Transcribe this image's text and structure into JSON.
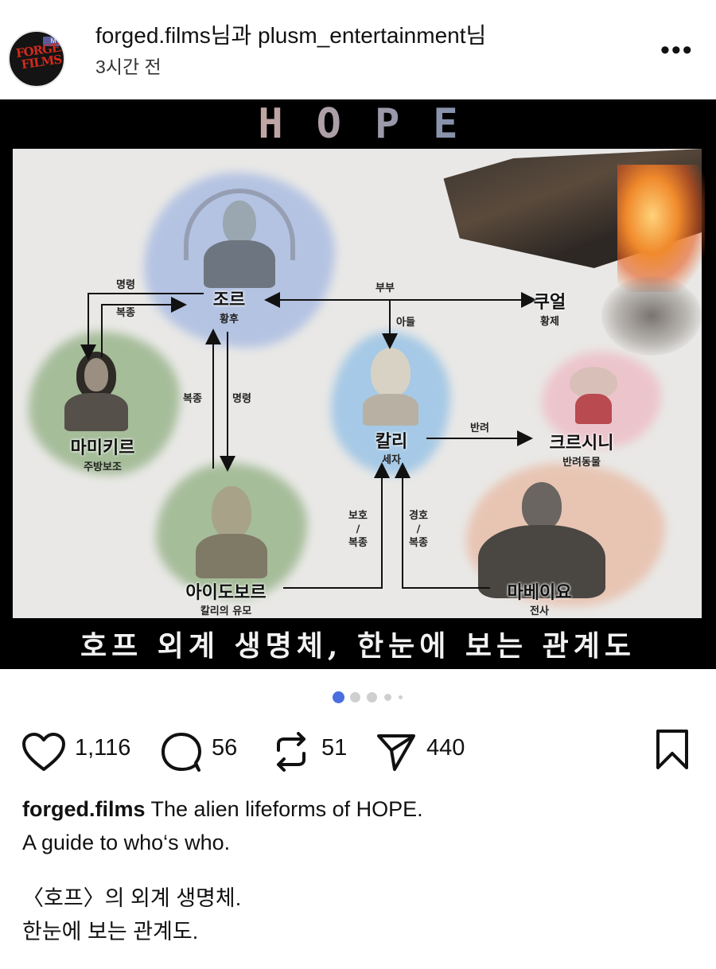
{
  "post": {
    "header": {
      "author_line": "forged.films님과 plusm_entertainment님",
      "time": "3시간 전",
      "avatar": {
        "logo_text": "FORGED FILMS",
        "badge_text": "M"
      },
      "more_icon": "ellipsis-icon"
    },
    "image": {
      "title": "HOPE",
      "caption": "호프 외계 생명체, 한눈에 보는 관계도",
      "characters": [
        {
          "name": "조르",
          "role": "황후"
        },
        {
          "name": "쿠얼",
          "role": "황제"
        },
        {
          "name": "마미키르",
          "role": "주방보조"
        },
        {
          "name": "칼리",
          "role": "세자"
        },
        {
          "name": "크르시니",
          "role": "반려동물"
        },
        {
          "name": "아이도보르",
          "role": "칼리의 유모"
        },
        {
          "name": "마베이요",
          "role": "전사"
        }
      ],
      "relations": {
        "command_top": "명령",
        "obey_top": "복종",
        "couple": "부부",
        "son": "아들",
        "obey_mid": "복종",
        "command_mid": "명령",
        "pet": "반려",
        "protect_obey": "보호\n/\n복종",
        "guard_obey": "경호\n/\n복종"
      },
      "colors": {
        "panel": "#e9e8e6",
        "blue_wash": "#8aa6e0",
        "green_wash": "#6f9a5c",
        "pink_wash": "#f0a9b8",
        "orange_wash": "#e8a88a"
      }
    },
    "carousel": {
      "count": 5,
      "active_index": 0,
      "active_color": "#4a6ee0"
    },
    "actions": {
      "likes": "1,116",
      "comments": "56",
      "reposts": "51",
      "shares": "440",
      "icons": [
        "heart-icon",
        "comment-icon",
        "repost-icon",
        "share-icon",
        "bookmark-icon"
      ]
    },
    "caption": {
      "username": "forged.films",
      "line1": "The alien lifeforms of HOPE.",
      "line2": "A guide to who‘s who.",
      "line3": "〈호프〉의 외계 생명체.",
      "line4": "한눈에 보는 관계도."
    }
  }
}
